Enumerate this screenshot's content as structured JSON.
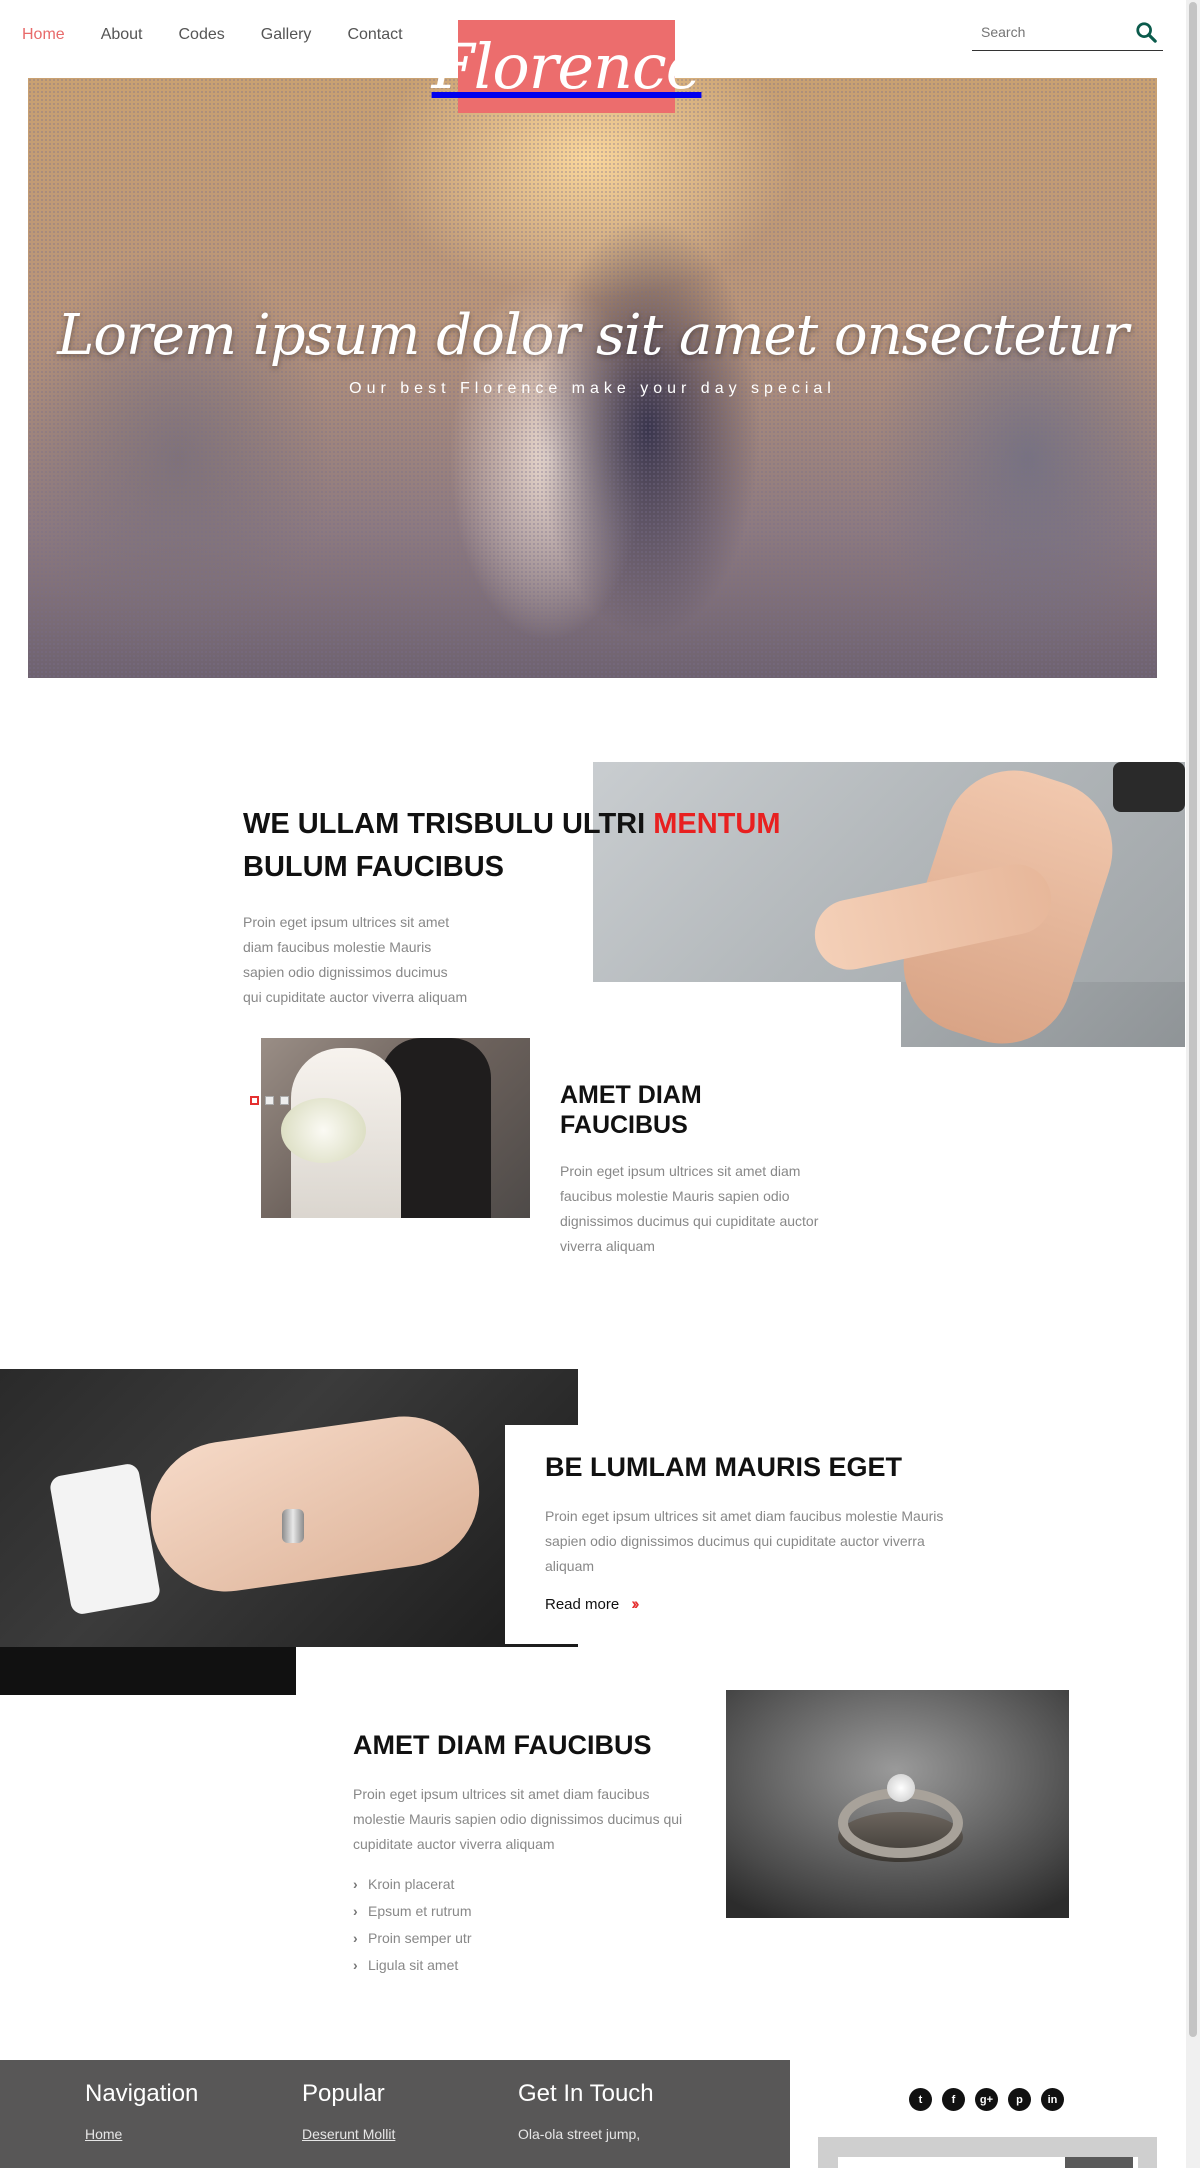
{
  "nav": {
    "items": [
      {
        "label": "Home",
        "active": true
      },
      {
        "label": "About",
        "active": false
      },
      {
        "label": "Codes",
        "active": false
      },
      {
        "label": "Gallery",
        "active": false
      },
      {
        "label": "Contact",
        "active": false
      }
    ]
  },
  "logo": {
    "text": "Florence",
    "color": "#ec6d6d"
  },
  "search": {
    "placeholder": "Search",
    "icon": "search-icon",
    "icon_color": "#0b5b4c"
  },
  "hero": {
    "title": "Lorem ipsum dolor sit amet onsectetur",
    "subtitle": "Our best Florence make your day special"
  },
  "section1": {
    "title_part1": "WE ULLAM TRISBULU ULTRI ",
    "title_highlight": "MENTUM",
    "title_part2": " BULUM FAUCIBUS",
    "text": "Proin eget ipsum ultrices sit amet diam faucibus molestie Mauris sapien odio dignissimos ducimus qui cupiditate auctor viverra aliquam",
    "highlight_color": "#e82020"
  },
  "section1b": {
    "title": "AMET DIAM FAUCIBUS",
    "text": "Proin eget ipsum ultrices sit amet diam faucibus molestie Mauris sapien odio dignissimos ducimus qui cupiditate auctor viverra aliquam",
    "slider_dots": 3,
    "active_dot": 0
  },
  "section2": {
    "title": "BE LUMLAM MAURIS EGET",
    "text": "Proin eget ipsum ultrices sit amet diam faucibus molestie Mauris sapien odio dignissimos ducimus qui cupiditate auctor viverra aliquam",
    "read_more": "Read more",
    "arrow_icon": "double-chevron-right-icon",
    "arrow_color": "#e53030"
  },
  "section3": {
    "title": "AMET DIAM FAUCIBUS",
    "text": "Proin eget ipsum ultrices sit amet diam faucibus molestie Mauris sapien odio dignissimos ducimus qui cupiditate auctor viverra aliquam",
    "list": [
      "Kroin placerat",
      "Epsum et rutrum",
      "Proin semper utr",
      "Ligula sit amet"
    ]
  },
  "footer": {
    "navigation": {
      "heading": "Navigation",
      "links": [
        "Home"
      ]
    },
    "popular": {
      "heading": "Popular",
      "links": [
        "Deserunt Mollit"
      ]
    },
    "contact": {
      "heading": "Get In Touch",
      "lines": [
        "Ola-ola street jump,"
      ]
    },
    "socials": [
      {
        "icon": "twitter-icon",
        "glyph": "t"
      },
      {
        "icon": "facebook-icon",
        "glyph": "f"
      },
      {
        "icon": "google-plus-icon",
        "glyph": "g+"
      },
      {
        "icon": "pinterest-icon",
        "glyph": "p"
      },
      {
        "icon": "linkedin-icon",
        "glyph": "in"
      }
    ],
    "dark_bg": "#585757"
  }
}
